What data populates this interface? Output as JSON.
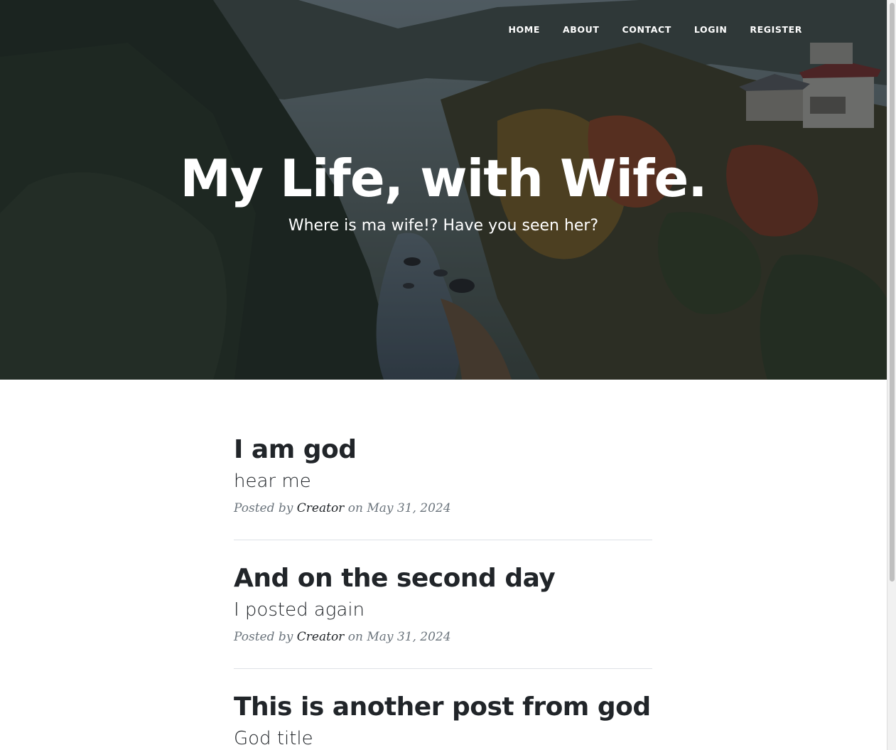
{
  "nav": {
    "home": "HOME",
    "about": "ABOUT",
    "contact": "CONTACT",
    "login": "LOGIN",
    "register": "REGISTER"
  },
  "hero": {
    "title": "My Life, with Wife.",
    "subtitle": "Where is ma wife!? Have you seen her?"
  },
  "posts": [
    {
      "title": "I am god",
      "subtitle": "hear me",
      "posted_by": "Posted by",
      "author": "Creator",
      "on": "on",
      "date": "May 31, 2024"
    },
    {
      "title": "And on the second day",
      "subtitle": "I posted again",
      "posted_by": "Posted by",
      "author": "Creator",
      "on": "on",
      "date": "May 31, 2024"
    },
    {
      "title": "This is another post from god",
      "subtitle": "God title"
    }
  ],
  "colors": {
    "text_dark": "#212529",
    "text_muted": "#6c757d",
    "divider": "#dee2e6"
  }
}
